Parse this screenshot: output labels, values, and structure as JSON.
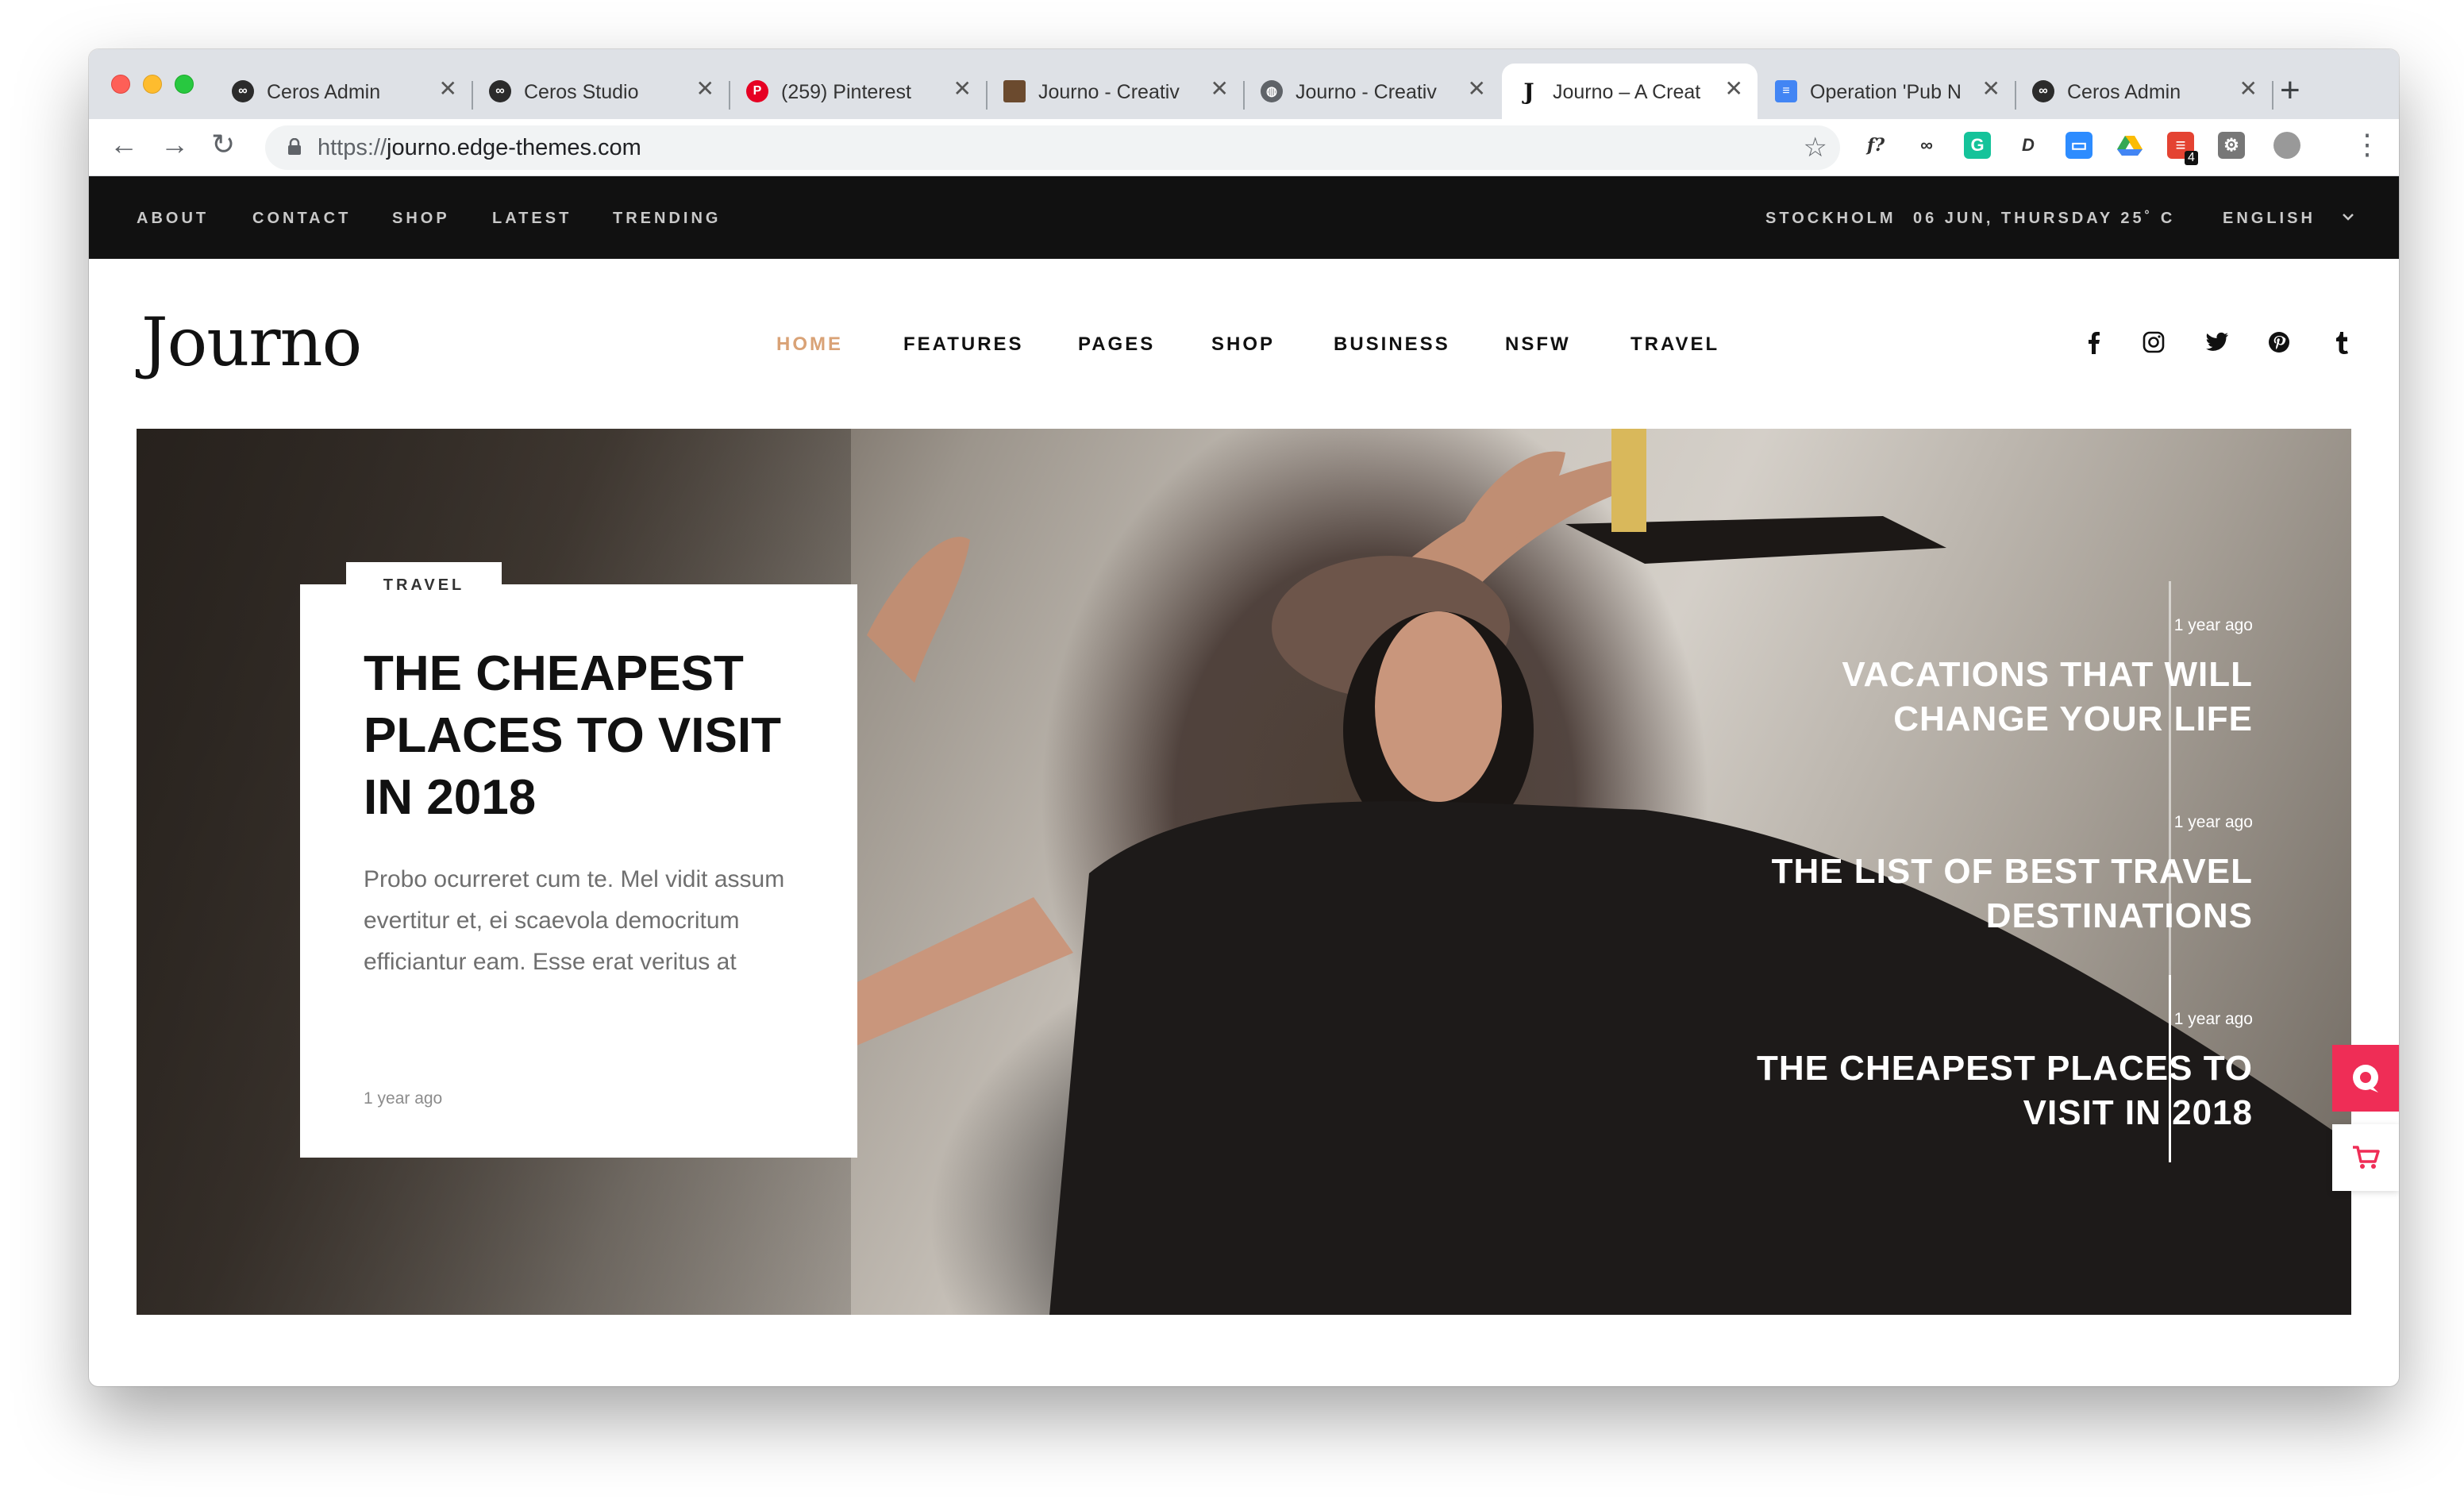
{
  "browser": {
    "tabs": [
      {
        "title": "Ceros Admin",
        "favicon": "ceros-icon"
      },
      {
        "title": "Ceros Studio",
        "favicon": "ceros-icon"
      },
      {
        "title": "(259) Pinterest",
        "favicon": "pinterest-icon"
      },
      {
        "title": "Journo - Creativ",
        "favicon": "image-icon"
      },
      {
        "title": "Journo - Creativ",
        "favicon": "globe-icon"
      },
      {
        "title": "Journo – A Creat",
        "favicon": "journo-icon"
      },
      {
        "title": "Operation 'Pub N",
        "favicon": "docs-icon"
      },
      {
        "title": "Ceros Admin",
        "favicon": "ceros-icon"
      }
    ],
    "active_tab": 5,
    "url_protocol": "https://",
    "url_host": "journo.edge-themes.com",
    "extension_badge": "4"
  },
  "topbar": {
    "links": [
      "ABOUT",
      "CONTACT",
      "SHOP",
      "LATEST",
      "TRENDING"
    ],
    "city": "STOCKHOLM",
    "date_weather": "06 JUN, THURSDAY 25˚ C",
    "language": "ENGLISH"
  },
  "header": {
    "logo": "Journo",
    "nav": [
      "HOME",
      "FEATURES",
      "PAGES",
      "SHOP",
      "BUSINESS",
      "NSFW",
      "TRAVEL"
    ],
    "active_nav": "HOME",
    "social": [
      "facebook-icon",
      "instagram-icon",
      "twitter-icon",
      "pinterest-icon",
      "tumblr-icon"
    ]
  },
  "hero": {
    "card": {
      "category": "TRAVEL",
      "title": "THE CHEAPEST PLACES TO VISIT IN 2018",
      "excerpt": "Probo ocurreret cum te. Mel vidit assum evertitur et, ei scaevola democritum efficiantur eam. Esse erat veritus at",
      "date": "1 year ago"
    },
    "side_posts": [
      {
        "date": "1 year ago",
        "title_line1": "VACATIONS THAT WILL",
        "title_line2": "CHANGE YOUR LIFE"
      },
      {
        "date": "1 year ago",
        "title_line1": "THE LIST OF BEST TRAVEL",
        "title_line2": "DESTINATIONS"
      },
      {
        "date": "1 year ago",
        "title_line1": "THE CHEAPEST PLACES TO",
        "title_line2": "VISIT IN 2018"
      }
    ],
    "active_side_post": 2
  },
  "colors": {
    "accent": "#d9a276",
    "topbar_bg": "#111111",
    "float_button": "#ef2d56"
  }
}
